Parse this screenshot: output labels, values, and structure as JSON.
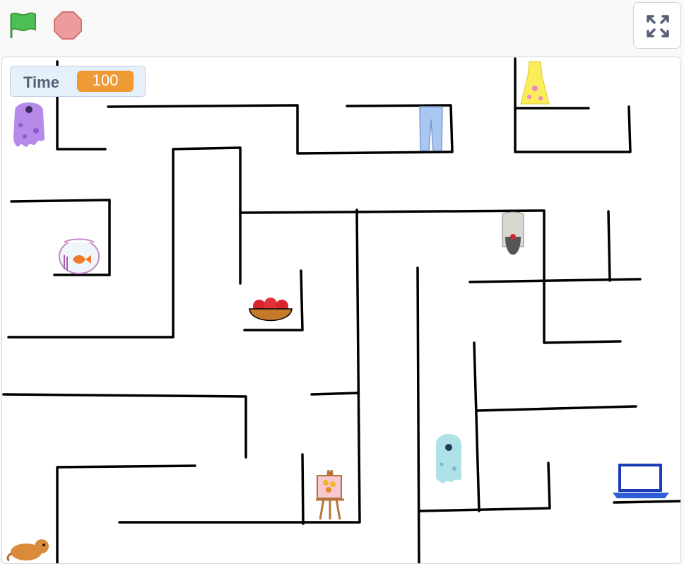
{
  "toolbar": {
    "green_flag_icon": "green-flag-icon",
    "stop_icon": "stop-sign-icon",
    "fullscreen_icon": "fullscreen-icon",
    "colors": {
      "flag": "#4cbf56",
      "stop": "#ec9c9c"
    }
  },
  "monitor": {
    "label": "Time",
    "value": "100",
    "colors": {
      "badge": "#f09a36",
      "panel": "#e6f0fb"
    }
  },
  "sprites": [
    "purple-monster-sprite",
    "fishbowl-sprite",
    "apple-bowl-sprite",
    "jeans-sprite",
    "dress-sprite",
    "bat-sprite",
    "blue-ghost-sprite",
    "easel-painting-sprite",
    "laptop-sprite",
    "hamster-sprite"
  ]
}
